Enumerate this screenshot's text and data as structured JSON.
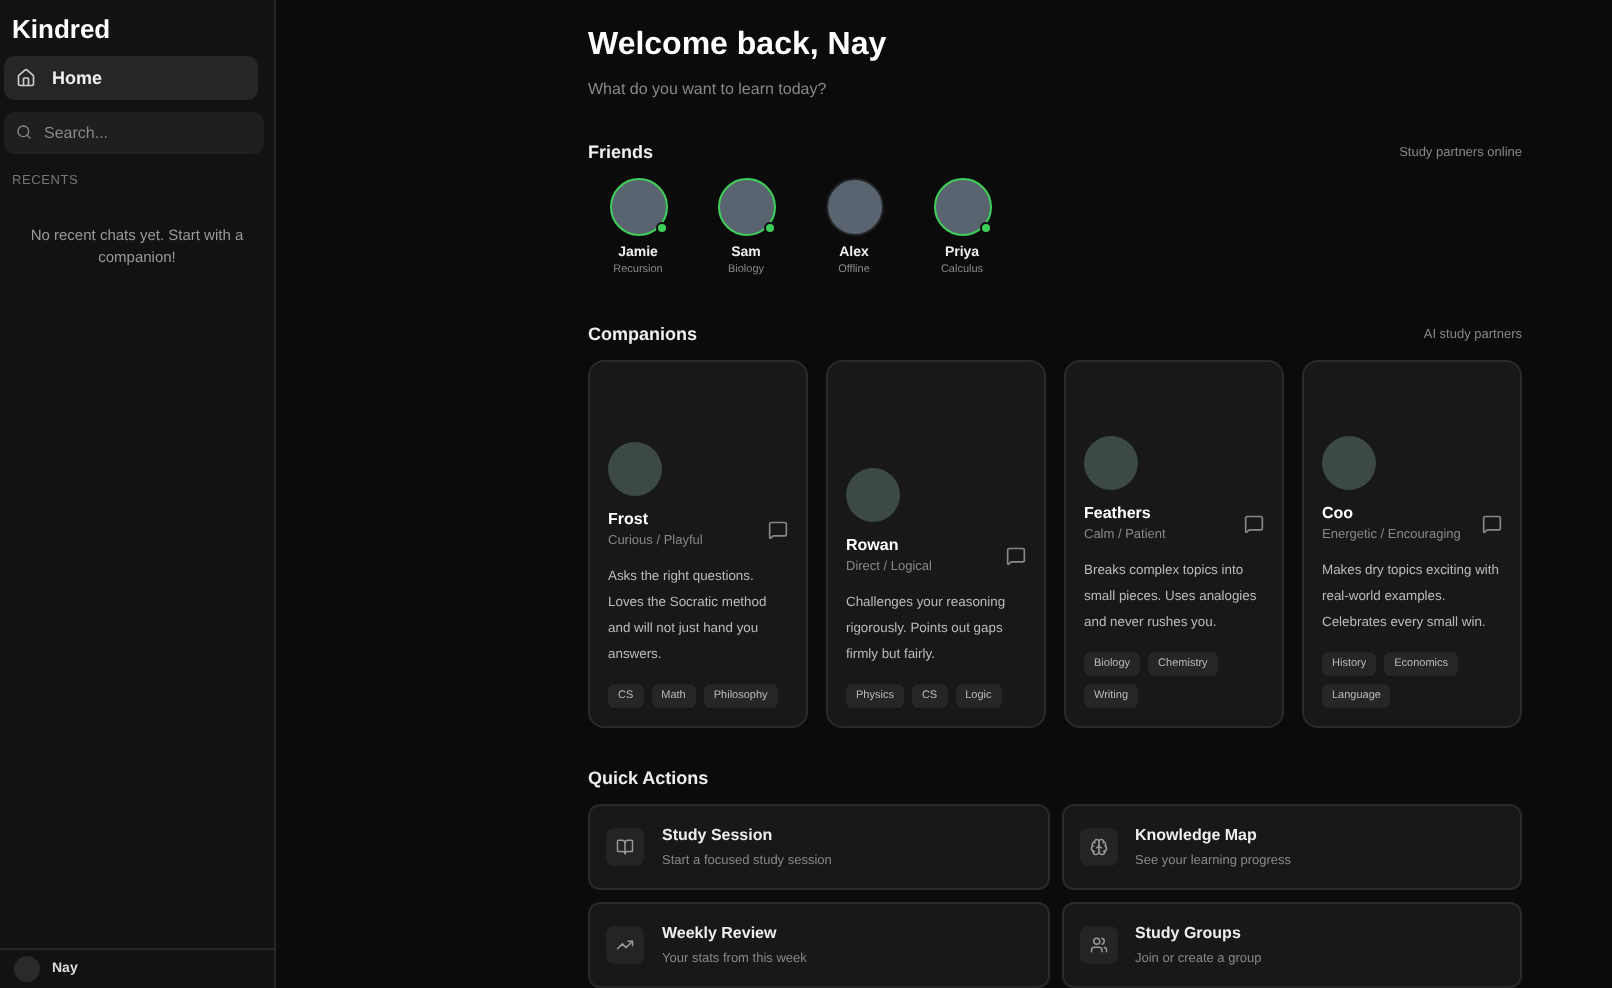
{
  "sidebar": {
    "brand": "Kindred",
    "nav": [
      {
        "label": "Home",
        "selected": true
      }
    ],
    "search": {
      "placeholder": "Search..."
    },
    "recents_heading": "RECENTS",
    "recents_empty": "No recent chats yet. Start with a companion!",
    "user": {
      "name": "Nay"
    }
  },
  "header": {
    "title": "Welcome back, Nay",
    "subtitle": "What do you want to learn today?"
  },
  "friends": {
    "heading": "Friends",
    "note": "Study partners online",
    "items": [
      {
        "name": "Jamie",
        "status": "Recursion",
        "online": true
      },
      {
        "name": "Sam",
        "status": "Biology",
        "online": true
      },
      {
        "name": "Alex",
        "status": "Offline",
        "online": false
      },
      {
        "name": "Priya",
        "status": "Calculus",
        "online": true
      }
    ]
  },
  "companions": {
    "heading": "Companions",
    "note": "AI study partners",
    "items": [
      {
        "name": "Frost",
        "traits": "Curious / Playful",
        "description": "Asks the right questions. Loves the Socratic method and will not just hand you answers.",
        "tags": [
          "CS",
          "Math",
          "Philosophy"
        ]
      },
      {
        "name": "Rowan",
        "traits": "Direct / Logical",
        "description": "Challenges your reasoning rigorously. Points out gaps firmly but fairly.",
        "tags": [
          "Physics",
          "CS",
          "Logic"
        ]
      },
      {
        "name": "Feathers",
        "traits": "Calm / Patient",
        "description": "Breaks complex topics into small pieces. Uses analogies and never rushes you.",
        "tags": [
          "Biology",
          "Chemistry",
          "Writing"
        ]
      },
      {
        "name": "Coo",
        "traits": "Energetic / Encouraging",
        "description": "Makes dry topics exciting with real-world examples. Celebrates every small win.",
        "tags": [
          "History",
          "Economics",
          "Language"
        ]
      }
    ]
  },
  "quick_actions": {
    "heading": "Quick Actions",
    "items": [
      {
        "kind": "book",
        "title": "Study Session",
        "subtitle": "Start a focused study session"
      },
      {
        "kind": "brain",
        "title": "Knowledge Map",
        "subtitle": "See your learning progress"
      },
      {
        "kind": "trend",
        "title": "Weekly Review",
        "subtitle": "Your stats from this week"
      },
      {
        "kind": "users",
        "title": "Study Groups",
        "subtitle": "Join or create a group"
      }
    ]
  }
}
